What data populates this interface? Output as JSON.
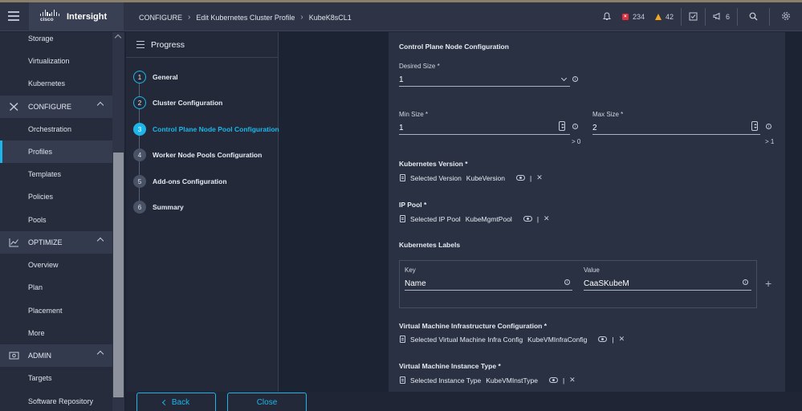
{
  "header": {
    "app_name": "Intersight",
    "logo_text": "cisco",
    "breadcrumb": [
      "CONFIGURE",
      "Edit Kubernetes Cluster Profile",
      "KubeK8sCL1"
    ],
    "alerts_critical": "234",
    "alerts_warning": "42",
    "announcements_count": "6"
  },
  "sidebar": {
    "top_items": [
      "Storage",
      "Virtualization",
      "Kubernetes"
    ],
    "configure": {
      "label": "CONFIGURE",
      "items": [
        "Orchestration",
        "Profiles",
        "Templates",
        "Policies",
        "Pools"
      ],
      "active": "Profiles"
    },
    "optimize": {
      "label": "OPTIMIZE",
      "items": [
        "Overview",
        "Plan",
        "Placement",
        "More"
      ]
    },
    "admin": {
      "label": "ADMIN",
      "items": [
        "Targets",
        "Software Repository"
      ]
    }
  },
  "progress": {
    "title": "Progress",
    "steps": [
      {
        "num": "1",
        "label": "General",
        "state": "done"
      },
      {
        "num": "2",
        "label": "Cluster Configuration",
        "state": "done"
      },
      {
        "num": "3",
        "label": "Control Plane Node Pool Configuration",
        "state": "current"
      },
      {
        "num": "4",
        "label": "Worker Node Pools Configuration",
        "state": "todo"
      },
      {
        "num": "5",
        "label": "Add-ons Configuration",
        "state": "todo"
      },
      {
        "num": "6",
        "label": "Summary",
        "state": "todo"
      }
    ]
  },
  "form": {
    "section_title": "Control Plane Node Configuration",
    "desired_size": {
      "label": "Desired Size *",
      "value": "1"
    },
    "min_size": {
      "label": "Min Size *",
      "value": "1",
      "hint": "> 0"
    },
    "max_size": {
      "label": "Max Size *",
      "value": "2",
      "hint": "> 1"
    },
    "kubernetes_version": {
      "label": "Kubernetes Version *",
      "selected_label": "Selected Version",
      "value": "KubeVersion",
      "pipe": "|"
    },
    "ip_pool": {
      "label": "IP Pool *",
      "selected_label": "Selected IP Pool",
      "value": "KubeMgmtPool",
      "pipe": "|"
    },
    "kubernetes_labels": {
      "label": "Kubernetes Labels",
      "key_label": "Key",
      "value_label": "Value",
      "key": "Name",
      "value": "CaaSKubeM"
    },
    "vm_infra_config": {
      "label": "Virtual Machine Infrastructure Configuration *",
      "selected_label": "Selected Virtual Machine Infra Config",
      "value": "KubeVMInfraConfig",
      "pipe": "|"
    },
    "vm_instance_type": {
      "label": "Virtual Machine Instance Type *",
      "selected_label": "Selected Instance Type",
      "value": "KubeVMInstType",
      "pipe": "|"
    }
  },
  "footer": {
    "back_label": "Back",
    "close_label": "Close"
  },
  "colors": {
    "accent": "#1eb6e9",
    "critical": "#e0303d",
    "warning": "#f5a623",
    "background": "#1c2333",
    "panel": "#2a3142"
  }
}
